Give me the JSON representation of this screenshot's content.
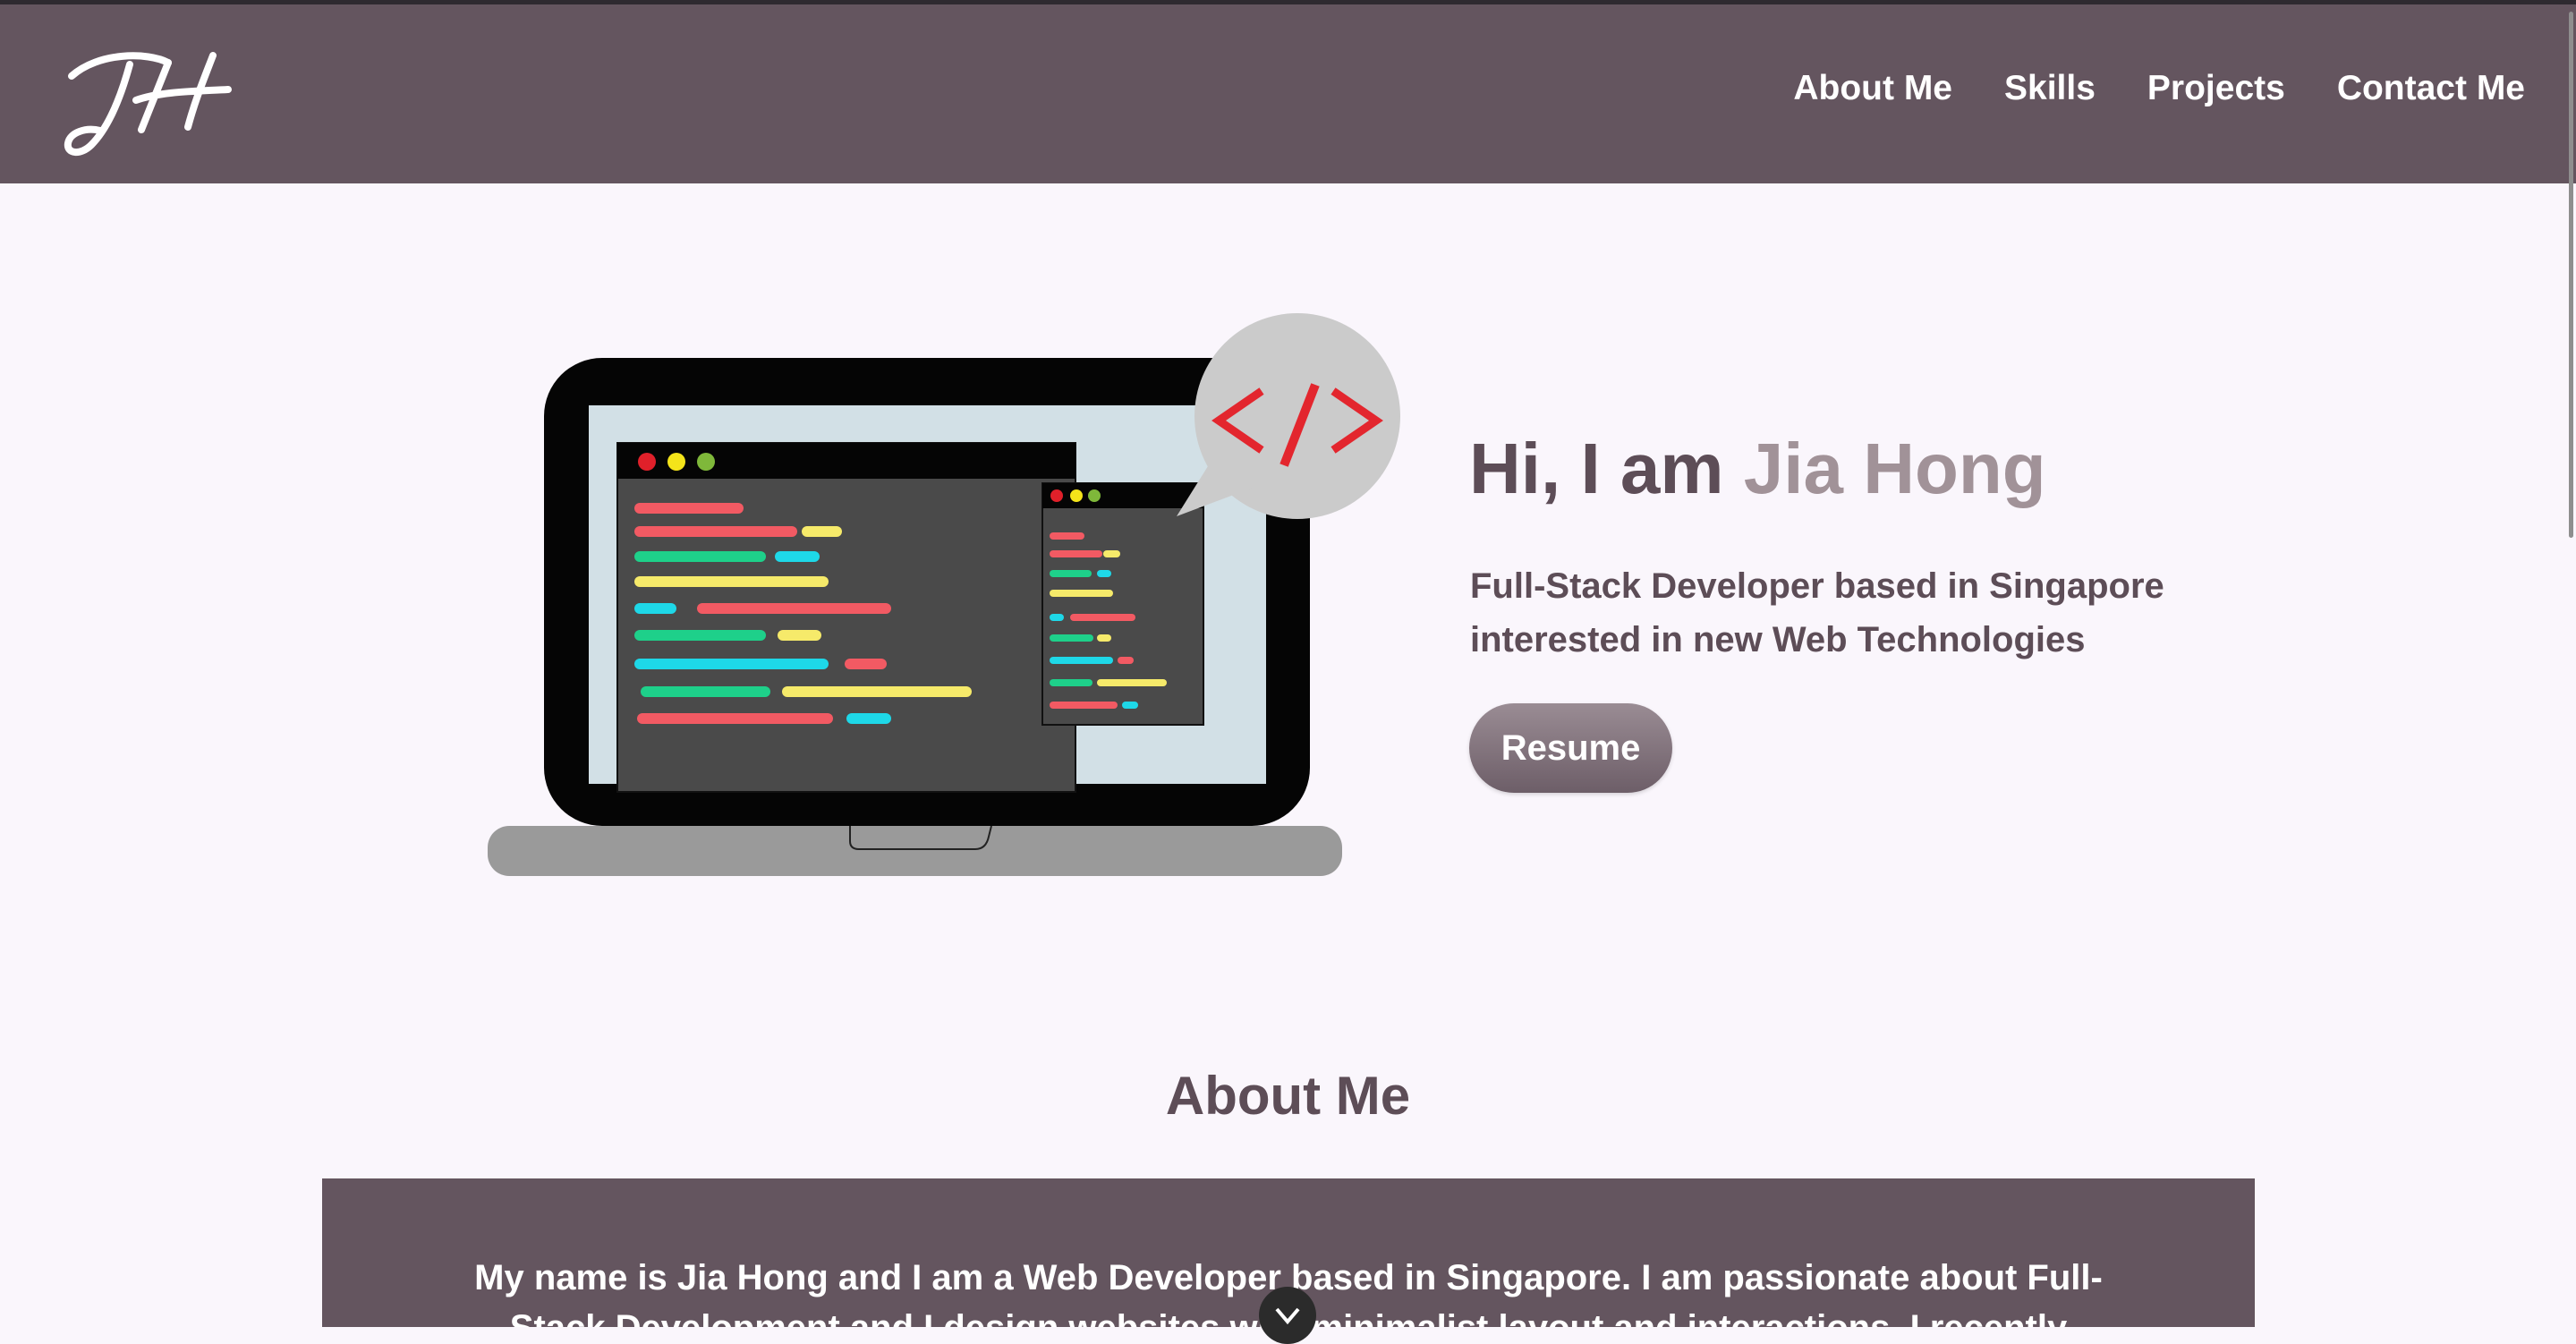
{
  "header": {
    "logo_text": "JH",
    "nav": [
      {
        "label": "About Me"
      },
      {
        "label": "Skills"
      },
      {
        "label": "Projects"
      },
      {
        "label": "Contact Me"
      }
    ]
  },
  "hero": {
    "greeting": "Hi, I am ",
    "name": "Jia Hong",
    "subtitle_line1": "Full-Stack Developer based in Singapore",
    "subtitle_line2": "interested in new Web Technologies",
    "resume_label": "Resume",
    "code_tag": "</>"
  },
  "about": {
    "heading": "About Me",
    "text": "My name is Jia Hong and I am a Web Developer based in Singapore. I am passionate about Full-Stack Development and I design websites with minimalist layout and interactions. I recently graduated from"
  },
  "scroll_button": {
    "icon": "chevron-down-icon"
  },
  "colors": {
    "header_bg": "#64555f",
    "page_bg": "#faf6fc",
    "accent": "#a19298",
    "heading_text": "#5d4d57"
  }
}
